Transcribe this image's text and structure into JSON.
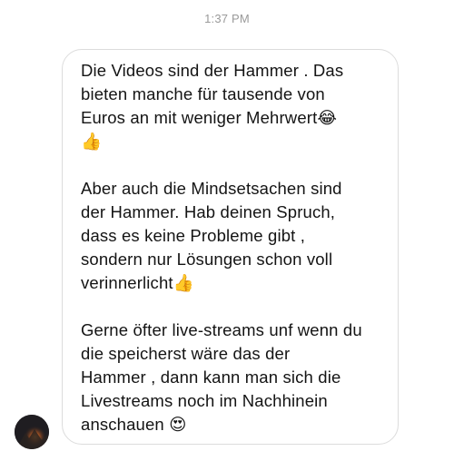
{
  "timestamp": "1:37 PM",
  "message": {
    "paragraphs": [
      {
        "lines": [
          "Die Videos sind der Hammer . Das",
          "bieten manche für tausende von",
          "Euros an mit weniger Mehrwert😂",
          "👍"
        ]
      },
      {
        "lines": [
          "Aber auch die Mindsetsachen sind",
          "der Hammer. Hab deinen Spruch,",
          "dass es keine Probleme gibt ,",
          "sondern nur Lösungen schon voll",
          "verinnerlicht👍"
        ]
      },
      {
        "lines": [
          "Gerne öfter live-streams unf wenn du",
          "die speicherst wäre das der",
          "Hammer , dann kann man sich die",
          "Livestreams noch im Nachhinein",
          "anschauen 😍"
        ]
      }
    ]
  },
  "colors": {
    "bubble_border": "#dcdcdc",
    "timestamp": "#9a9a9a",
    "text": "#141414"
  }
}
